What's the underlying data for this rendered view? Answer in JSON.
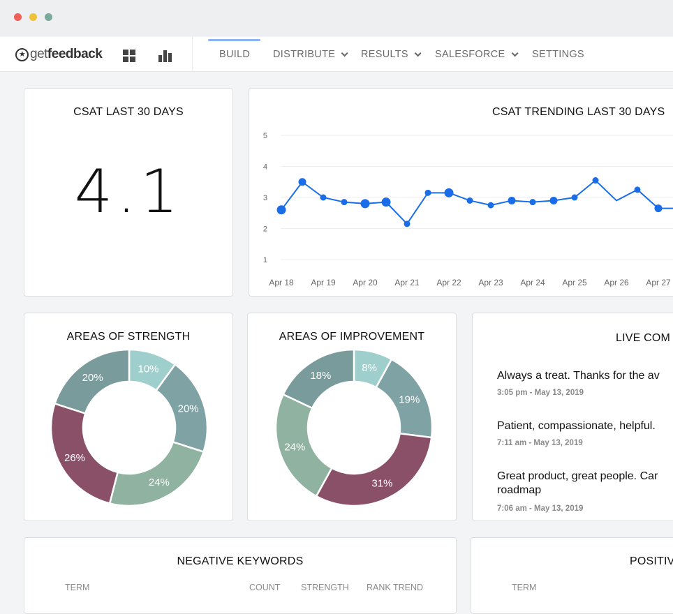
{
  "window": {
    "controls": [
      "close",
      "minimize",
      "maximize"
    ]
  },
  "app": {
    "logo_prefix": "get",
    "logo_suffix": "feedback",
    "icons": [
      "dashboard-grid-icon",
      "bar-chart-icon"
    ]
  },
  "nav": {
    "items": [
      {
        "label": "BUILD",
        "has_dropdown": false,
        "active": true
      },
      {
        "label": "DISTRIBUTE",
        "has_dropdown": true
      },
      {
        "label": "RESULTS",
        "has_dropdown": true
      },
      {
        "label": "SALESFORCE",
        "has_dropdown": true
      },
      {
        "label": "SETTINGS",
        "has_dropdown": false
      }
    ]
  },
  "csat": {
    "title": "CSAT LAST 30 DAYS",
    "value": "4.1"
  },
  "trend": {
    "title": "CSAT TRENDING LAST 30 DAYS",
    "chart_data": {
      "type": "line",
      "ylim": [
        1,
        5
      ],
      "yticks": [
        1,
        2,
        3,
        4,
        5
      ],
      "xticks": [
        "Apr 18",
        "Apr 19",
        "Apr 20",
        "Apr 21",
        "Apr 22",
        "Apr 23",
        "Apr 24",
        "Apr 25",
        "Apr 26",
        "Apr 27"
      ],
      "color": "#1a6de8",
      "points": [
        {
          "x": 0,
          "y": 2.6,
          "size": "large"
        },
        {
          "x": 0.5,
          "y": 3.5,
          "size": "medium"
        },
        {
          "x": 1,
          "y": 3.0,
          "size": "small"
        },
        {
          "x": 1.5,
          "y": 2.85,
          "size": "small"
        },
        {
          "x": 2,
          "y": 2.8,
          "size": "large"
        },
        {
          "x": 2.5,
          "y": 2.85,
          "size": "large"
        },
        {
          "x": 3,
          "y": 2.15,
          "size": "small"
        },
        {
          "x": 3.5,
          "y": 3.15,
          "size": "small"
        },
        {
          "x": 4,
          "y": 3.15,
          "size": "large"
        },
        {
          "x": 4.5,
          "y": 2.9,
          "size": "small"
        },
        {
          "x": 5,
          "y": 2.75,
          "size": "small"
        },
        {
          "x": 5.5,
          "y": 2.9,
          "size": "medium"
        },
        {
          "x": 6,
          "y": 2.85,
          "size": "small"
        },
        {
          "x": 6.5,
          "y": 2.9,
          "size": "medium"
        },
        {
          "x": 7,
          "y": 3.0,
          "size": "small"
        },
        {
          "x": 7.5,
          "y": 3.55,
          "size": "small"
        },
        {
          "x": 8,
          "y": 2.9,
          "size": "none"
        },
        {
          "x": 8.5,
          "y": 3.25,
          "size": "small"
        },
        {
          "x": 9,
          "y": 2.65,
          "size": "medium"
        },
        {
          "x": 9.5,
          "y": 2.65,
          "size": "medium"
        }
      ]
    }
  },
  "strength": {
    "title": "AREAS OF STRENGTH",
    "chart_data": {
      "type": "pie",
      "donut": true,
      "slices": [
        {
          "value": 10,
          "label": "10%",
          "color": "#9fcfcd"
        },
        {
          "value": 20,
          "label": "20%",
          "color": "#7fa2a4"
        },
        {
          "value": 24,
          "label": "24%",
          "color": "#90b2a1"
        },
        {
          "value": 26,
          "label": "26%",
          "color": "#8a5068"
        },
        {
          "value": 20,
          "label": "20%",
          "color": "#7a9b9c"
        }
      ]
    }
  },
  "improvement": {
    "title": "AREAS OF IMPROVEMENT",
    "chart_data": {
      "type": "pie",
      "donut": true,
      "slices": [
        {
          "value": 8,
          "label": "8%",
          "color": "#9fcfcd"
        },
        {
          "value": 19,
          "label": "19%",
          "color": "#7fa2a4"
        },
        {
          "value": 31,
          "label": "31%",
          "color": "#8a5068"
        },
        {
          "value": 24,
          "label": "24%",
          "color": "#90b2a1"
        },
        {
          "value": 18,
          "label": "18%",
          "color": "#7a9b9c"
        }
      ]
    }
  },
  "live": {
    "title": "LIVE COM",
    "comments": [
      {
        "text": "Always a treat. Thanks for the av",
        "time": "3:05 pm - May 13, 2019"
      },
      {
        "text": "Patient, compassionate, helpful.",
        "time": "7:11 am - May 13, 2019"
      },
      {
        "text_line1": "Great product, great people. Car",
        "text_line2": "roadmap",
        "time": "7:06 am - May 13, 2019"
      }
    ]
  },
  "negative": {
    "title": "NEGATIVE KEYWORDS",
    "columns": [
      "TERM",
      "COUNT",
      "STRENGTH",
      "RANK TREND"
    ]
  },
  "positive": {
    "title": "POSITIV",
    "columns": [
      "TERM"
    ]
  }
}
